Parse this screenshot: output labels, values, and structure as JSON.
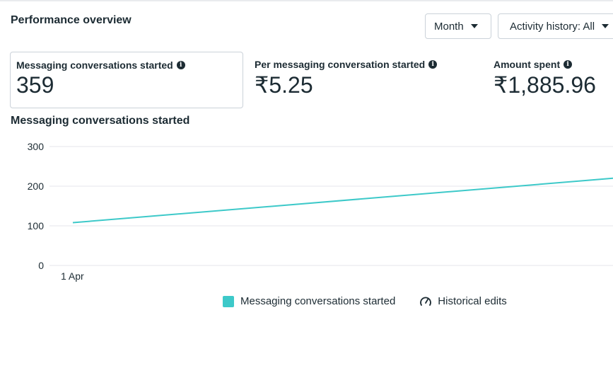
{
  "header": {
    "title": "Performance overview"
  },
  "controls": {
    "month_label": "Month",
    "activity_label": "Activity history: All"
  },
  "metrics": [
    {
      "label": "Messaging conversations started",
      "value": "359"
    },
    {
      "label": "Per messaging conversation started",
      "value": "₹5.25"
    },
    {
      "label": "Amount spent",
      "value": "₹1,885.96"
    }
  ],
  "chart": {
    "heading": "Messaging conversations started"
  },
  "legend": {
    "series_label": "Messaging conversations started",
    "edits_label": "Historical edits"
  },
  "colors": {
    "series": "#3dc9c9",
    "grid": "#e4e6eb",
    "text": "#1c2b33"
  },
  "chart_data": {
    "type": "line",
    "title": "Messaging conversations started",
    "x": [
      "1 Apr",
      ""
    ],
    "series": [
      {
        "name": "Messaging conversations started",
        "values": [
          108,
          220
        ]
      }
    ],
    "yticks": [
      0,
      100,
      200,
      300
    ],
    "ylim": [
      0,
      300
    ],
    "xtick_labels": [
      "1 Apr"
    ],
    "grid": true,
    "legend": "bottom"
  }
}
